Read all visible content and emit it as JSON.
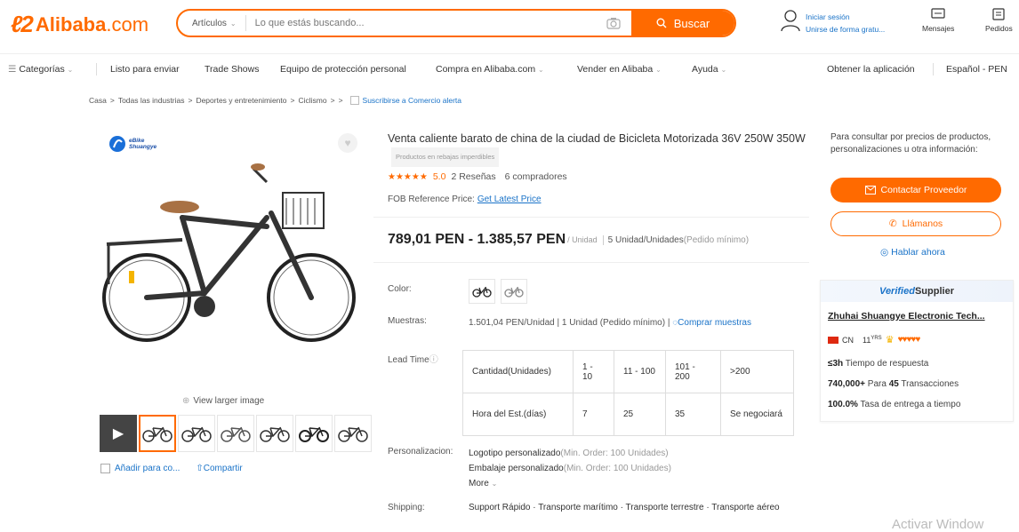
{
  "header": {
    "logo_text": "Alibaba",
    "logo_suffix": ".com",
    "search_category": "Artículos",
    "search_placeholder": "Lo que estás buscando...",
    "search_button": "Buscar",
    "signin": "Iniciar sesión",
    "join": "Unirse de forma gratu...",
    "messages": "Mensajes",
    "orders": "Pedidos"
  },
  "nav": {
    "categories": "Categorías",
    "items": [
      "Listo para enviar",
      "Trade Shows",
      "Equipo de protección personal",
      "Compra en Alibaba.com",
      "Vender en Alibaba",
      "Ayuda"
    ],
    "get_app": "Obtener la aplicación",
    "language": "Español - PEN"
  },
  "breadcrumb": {
    "items": [
      "Casa",
      "Todas las industrias",
      "Deportes y entretenimiento",
      "Ciclismo",
      "",
      ""
    ],
    "subscribe": "Suscribirse a Comercio alerta"
  },
  "gallery": {
    "brand_line1": "eBike",
    "brand_line2": "Shuangye",
    "view_larger": "View larger image",
    "add_compare": "Añadir para co...",
    "share": "Compartir"
  },
  "product": {
    "title": "Venta caliente barato de china de la ciudad de Bicicleta Motorizada 36V 250W 350W",
    "tag": "Productos en rebajas imperdibles",
    "rating": "5.0",
    "reviews": "2 Reseñas",
    "buyers": "6 compradores",
    "fob_label": "FOB Reference Price:",
    "fob_link": "Get Latest Price",
    "price": "789,01 PEN - 1.385,57 PEN",
    "unit": "/ Unidad",
    "moq": "5 Unidad/Unidades",
    "moq_suffix": "(Pedido mínimo)",
    "color_label": "Color:",
    "samples_label": "Muestras:",
    "samples_value": "1.501,04 PEN/Unidad | 1 Unidad (Pedido mínimo) |",
    "samples_link": "Comprar muestras",
    "lead_label": "Lead Time",
    "lead_table": {
      "qty_header": "Cantidad(Unidades)",
      "qty": [
        "1 - 10",
        "11 - 100",
        "101 - 200",
        ">200"
      ],
      "time_header": "Hora del Est.(días)",
      "times": [
        "7",
        "25",
        "35",
        "Se negociará"
      ]
    },
    "custom_label": "Personalizacion:",
    "custom_logo": "Logotipo personalizado",
    "custom_logo_min": "(Min. Order: 100 Unidades)",
    "custom_pack": "Embalaje personalizado",
    "custom_pack_min": "(Min. Order: 100 Unidades)",
    "more": "More",
    "shipping_label": "Shipping:",
    "shipping_value": "Support Rápido · Transporte marítimo · Transporte terrestre · Transporte aéreo"
  },
  "side": {
    "note": "Para consultar por precios de productos, personalizaciones u otra información:",
    "contact_button": "Contactar Proveedor",
    "call_button": "Llámanos",
    "chat_now": "Hablar ahora",
    "verified_v": "Verified",
    "verified_rest": " Supplier",
    "supplier_name": "Zhuhai Shuangye Electronic Tech...",
    "country": "CN",
    "years": "11",
    "years_unit": "YRS",
    "response_value": "≤3h",
    "response_label": "Tiempo de respuesta",
    "tx_value": "740,000+",
    "tx_mid": "Para",
    "tx_count": "45",
    "tx_label": "Transacciones",
    "delivery_value": "100.0%",
    "delivery_label": "Tasa de entrega a tiempo"
  },
  "watermark": "Activar Window"
}
